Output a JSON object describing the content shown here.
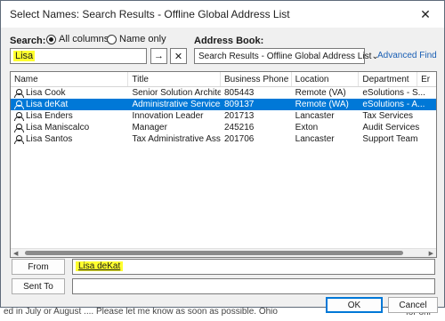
{
  "window": {
    "title": "Select Names: Search Results - Offline Global Address List",
    "close": "✕"
  },
  "search": {
    "label": "Search:",
    "value": "Lisa",
    "radio_all": "All columns",
    "radio_name": "Name only",
    "go": "→",
    "clear": "✕"
  },
  "address_book": {
    "label": "Address Book:",
    "selected": "Search Results - Offline Global Address List",
    "advanced": "Advanced Find"
  },
  "table": {
    "headers": [
      "Name",
      "Title",
      "Business Phone",
      "Location",
      "Department",
      "Er"
    ],
    "rows": [
      {
        "name": "Lisa Cook",
        "title": "Senior Solution Architect",
        "phone": "805443",
        "location": "Remote (VA)",
        "department": "eSolutions - S..."
      },
      {
        "name": "Lisa deKat",
        "title": "Administrative Services ...",
        "phone": "809137",
        "location": "Remote (WA)",
        "department": "eSolutions - A..."
      },
      {
        "name": "Lisa Enders",
        "title": "Innovation Leader",
        "phone": "201713",
        "location": "Lancaster",
        "department": "Tax Services"
      },
      {
        "name": "Lisa Maniscalco",
        "title": "Manager",
        "phone": "245216",
        "location": "Exton",
        "department": "Audit Services"
      },
      {
        "name": "Lisa Santos",
        "title": "Tax Administrative Assi...",
        "phone": "201706",
        "location": "Lancaster",
        "department": "Support Team"
      }
    ],
    "selected_index": 1
  },
  "from": {
    "button": "From",
    "value": "Lisa deKat"
  },
  "sent_to": {
    "button": "Sent To",
    "value": ""
  },
  "ok": "OK",
  "cancel": "Cancel",
  "background_text": "ed in July or August .... Please let me know as soon as possible. Ohio",
  "background_text_right": "for onl",
  "colors": {
    "selection": "#0078d7",
    "highlight": "#ffff2e"
  }
}
